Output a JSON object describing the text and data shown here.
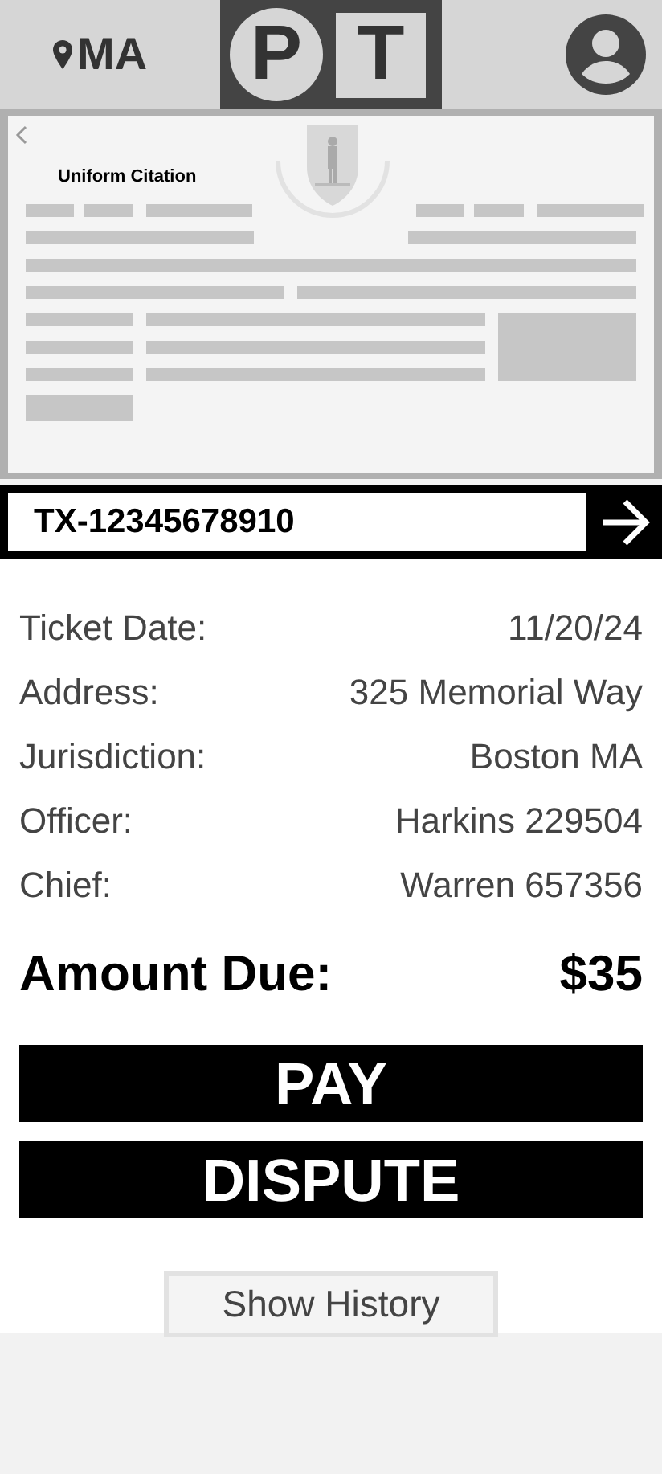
{
  "header": {
    "location": "MA",
    "logo": [
      "P",
      "T"
    ]
  },
  "citation": {
    "title": "Uniform Citation"
  },
  "ticket_search": {
    "value": "TX-12345678910"
  },
  "details": [
    {
      "label": "Ticket Date:",
      "value": "11/20/24"
    },
    {
      "label": "Address:",
      "value": "325 Memorial Way"
    },
    {
      "label": "Jurisdiction:",
      "value": "Boston MA"
    },
    {
      "label": "Officer:",
      "value": "Harkins 229504"
    },
    {
      "label": "Chief:",
      "value": "Warren 657356"
    }
  ],
  "amount_due": {
    "label": "Amount Due:",
    "value": "$35"
  },
  "actions": [
    "PAY",
    "DISPUTE"
  ],
  "history_button": "Show History"
}
